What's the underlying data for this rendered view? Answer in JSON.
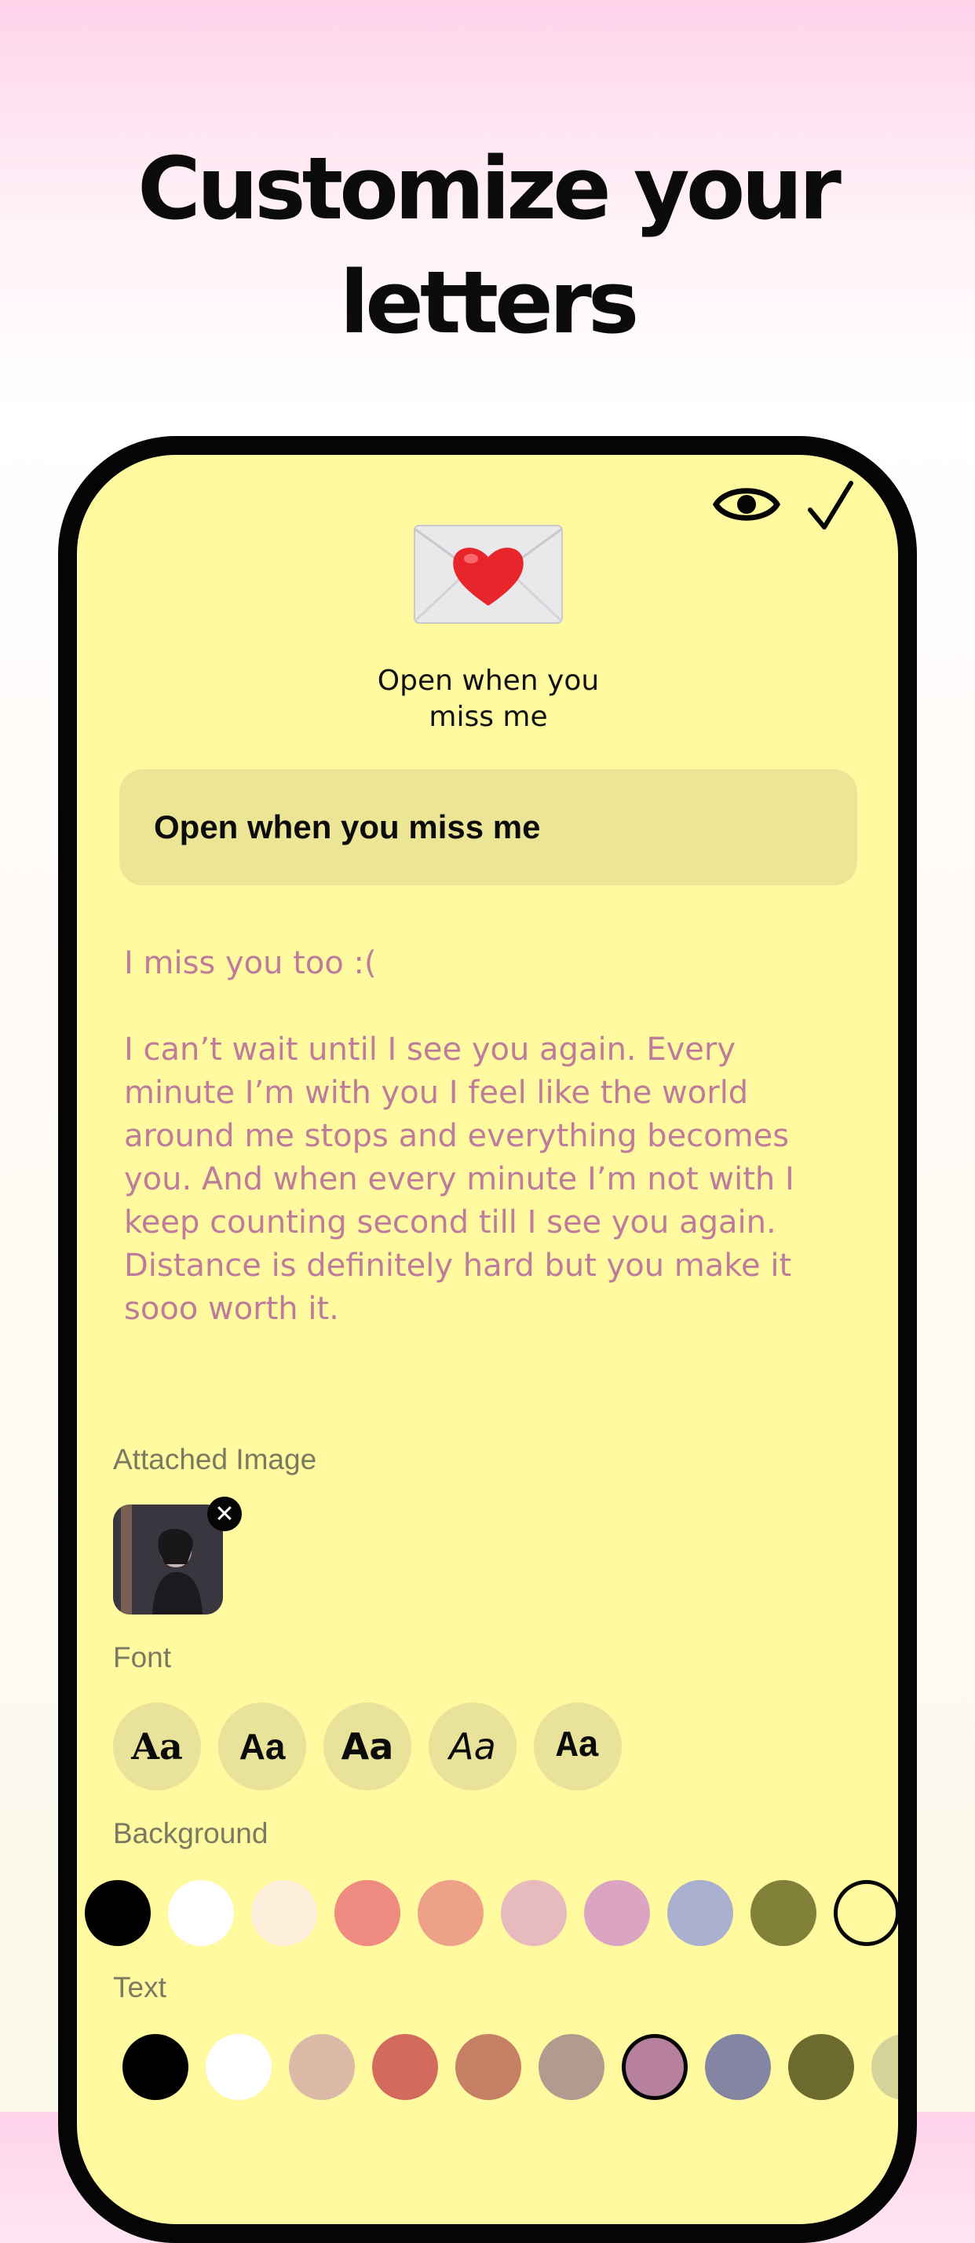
{
  "headline": {
    "line1": "Customize your",
    "line2": "letters"
  },
  "toolbar": {
    "preview_icon": "eye-icon",
    "done_icon": "checkmark-icon"
  },
  "envelope": {
    "icon": "love-letter-envelope",
    "title_line1": "Open when you",
    "title_line2": "miss me"
  },
  "title_field": {
    "value": "Open when you miss me"
  },
  "letter_body": {
    "value": "I miss you too :(\n\nI can’t wait until I see you again. Every\nminute I’m with you I feel like the world\naround me stops and everything becomes\nyou. And when every minute I’m not with I\nkeep counting second till I see you again.\nDistance is definitely hard but you make it\nsooo worth it."
  },
  "attached_image": {
    "label": "Attached Image",
    "remove_glyph": "✕"
  },
  "font": {
    "label": "Font",
    "options": [
      "Aa",
      "Aa",
      "Aa",
      "Aa",
      "Aa"
    ]
  },
  "background": {
    "label": "Background",
    "colors": [
      "#000000",
      "#ffffff",
      "#fdefdc",
      "#ef8a80",
      "#eea189",
      "#e7babd",
      "#dba5c2",
      "#aab0cf",
      "#828139",
      "#fffa9f"
    ],
    "selected_index": 9
  },
  "text": {
    "label": "Text",
    "colors": [
      "#000000",
      "#ffffff",
      "#ddbaa8",
      "#d36a5e",
      "#c68066",
      "#b29b8e",
      "#b7809e",
      "#8485a3",
      "#6c6a2c",
      "#d6d39a"
    ],
    "selected_index": 6
  }
}
